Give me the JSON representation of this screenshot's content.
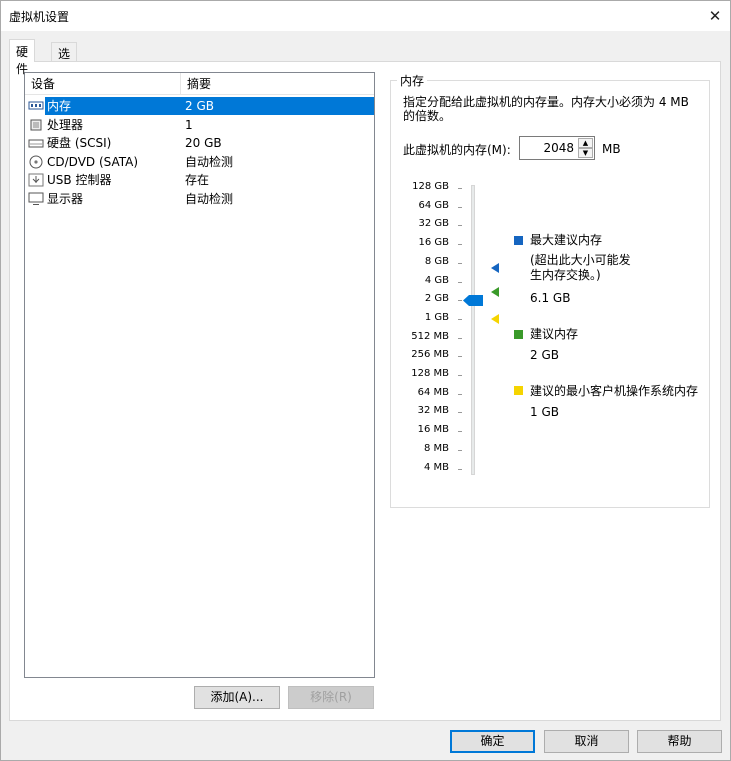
{
  "window": {
    "title": "虚拟机设置",
    "close_icon": "close-icon"
  },
  "tabs": [
    {
      "label": "硬件",
      "active": true
    },
    {
      "label": "选项",
      "active": false
    }
  ],
  "device_list": {
    "columns": [
      "设备",
      "摘要"
    ],
    "rows": [
      {
        "name": "内存",
        "summary": "2 GB",
        "icon": "memory-icon",
        "selected": true
      },
      {
        "name": "处理器",
        "summary": "1",
        "icon": "processor-icon",
        "selected": false
      },
      {
        "name": "硬盘 (SCSI)",
        "summary": "20 GB",
        "icon": "hard-disk-icon",
        "selected": false
      },
      {
        "name": "CD/DVD (SATA)",
        "summary": "自动检测",
        "icon": "cd-dvd-icon",
        "selected": false
      },
      {
        "name": "USB 控制器",
        "summary": "存在",
        "icon": "usb-icon",
        "selected": false
      },
      {
        "name": "显示器",
        "summary": "自动检测",
        "icon": "display-icon",
        "selected": false
      }
    ]
  },
  "list_buttons": {
    "add": "添加(A)...",
    "remove": "移除(R)"
  },
  "memory": {
    "group_title": "内存",
    "description": "指定分配给此虚拟机的内存量。内存大小必须为 4 MB 的倍数。",
    "field_label": "此虚拟机的内存(M):",
    "value": "2048",
    "unit": "MB",
    "scale_labels": [
      "128 GB",
      "64 GB",
      "32 GB",
      "16 GB",
      "8 GB",
      "4 GB",
      "2 GB",
      "1 GB",
      "512 MB",
      "256 MB",
      "128 MB",
      "64 MB",
      "32 MB",
      "16 MB",
      "8 MB",
      "4 MB"
    ],
    "current_level": "2 GB",
    "legend": {
      "max": {
        "title": "最大建议内存",
        "note": "(超出此大小可能发生内存交换。)",
        "value": "6.1 GB",
        "color": "#1565c0"
      },
      "recommended": {
        "title": "建议内存",
        "value": "2 GB",
        "color": "#3a9a2a"
      },
      "min": {
        "title": "建议的最小客户机操作系统内存",
        "value": "1 GB",
        "color": "#f5d400"
      }
    },
    "accent_color": "#0078d7"
  },
  "footer_buttons": {
    "ok": "确定",
    "cancel": "取消",
    "help": "帮助"
  }
}
